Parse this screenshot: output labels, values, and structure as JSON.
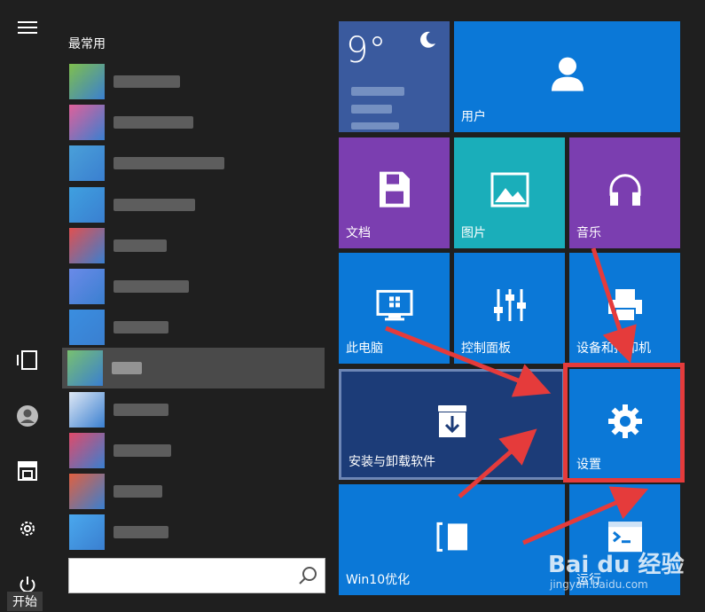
{
  "left_rail": {
    "menu_icon": "hamburger-icon",
    "items": [
      {
        "name": "tablet-mode-icon"
      },
      {
        "name": "user-account-icon"
      },
      {
        "name": "documents-icon"
      },
      {
        "name": "settings-gear-icon"
      },
      {
        "name": "power-icon"
      }
    ],
    "start_label": "开始"
  },
  "app_list": {
    "section_title": "最常用",
    "apps": [
      {
        "icon_color": "#7fbf4d",
        "name_color": "#8f8f8f",
        "name_width": 75
      },
      {
        "icon_color": "#e0609a",
        "name_color": "#8f8f8f",
        "name_width": 90
      },
      {
        "icon_color": "#4aa0d9",
        "name_color": "#8f8f8f",
        "name_width": 125
      },
      {
        "icon_color": "#3fa0e0",
        "name_color": "#8f8f8f",
        "name_width": 92
      },
      {
        "icon_color": "#e05050",
        "name_color": "#8f8f8f",
        "name_width": 60
      },
      {
        "icon_color": "#6a8ae8",
        "name_color": "#8f8f8f",
        "name_width": 85
      },
      {
        "icon_color": "#3a8ee0",
        "name_color": "#8f8f8f",
        "name_width": 62
      },
      {
        "icon_color": "#78c070",
        "name_color": "#cfcfcf",
        "name_width": 34,
        "highlighted": true
      },
      {
        "icon_color": "#dfe8f5",
        "name_color": "#8f8f8f",
        "name_width": 62
      },
      {
        "icon_color": "#e04a6a",
        "name_color": "#8f8f8f",
        "name_width": 65
      },
      {
        "icon_color": "#e06040",
        "name_color": "#8f8f8f",
        "name_width": 55
      },
      {
        "icon_color": "#4aa8ee",
        "name_color": "#8f8f8f",
        "name_width": 62
      }
    ]
  },
  "tiles": {
    "weather": {
      "temp": "9°",
      "icon": "moon-icon"
    },
    "users": {
      "label": "用户",
      "icon": "person-icon"
    },
    "documents": {
      "label": "文档",
      "icon": "save-document-icon"
    },
    "pictures": {
      "label": "图片",
      "icon": "picture-icon"
    },
    "music": {
      "label": "音乐",
      "icon": "headphones-icon"
    },
    "this_pc": {
      "label": "此电脑",
      "icon": "monitor-icon"
    },
    "control_panel": {
      "label": "控制面板",
      "icon": "sliders-icon"
    },
    "devices_printers": {
      "label": "设备和打印机",
      "icon": "printer-icon"
    },
    "install_uninstall": {
      "label": "安装与卸载软件",
      "icon": "install-box-icon"
    },
    "settings": {
      "label": "设置",
      "icon": "gear-icon"
    },
    "win10_optimize": {
      "label": "Win10优化",
      "icon": "bracket-icon"
    },
    "run": {
      "label": "运行",
      "icon": "console-icon"
    }
  },
  "watermark": {
    "title": "Bai du 经验",
    "sub": "jingyan.baidu.com"
  },
  "colors": {
    "tile_blue": "#0b78d7",
    "tile_purple": "#7b3eb0",
    "tile_teal": "#1aaeba",
    "tile_darkblue": "#1c3c78",
    "weather_bg": "#3a5a9e",
    "accent_red": "#e53b3b"
  }
}
